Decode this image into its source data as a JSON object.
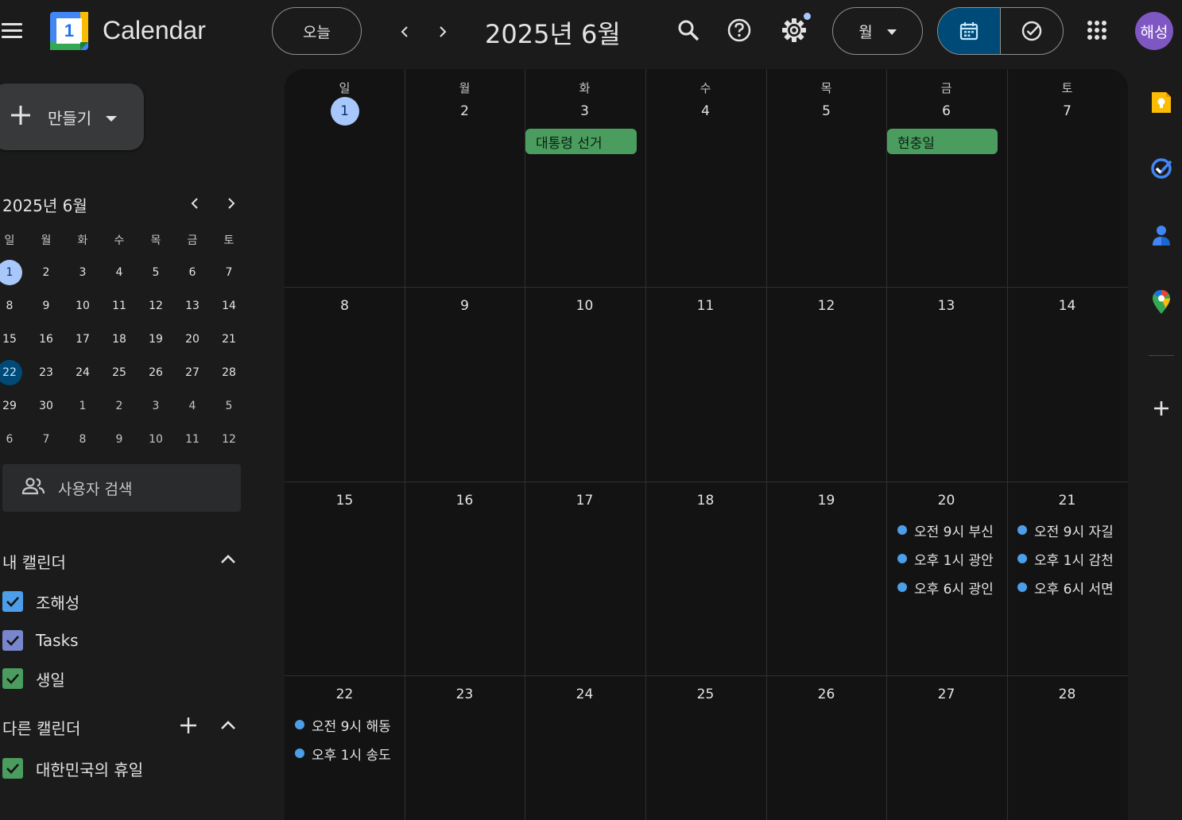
{
  "header": {
    "app_title": "Calendar",
    "logo_day": "1",
    "today_label": "오늘",
    "period_title": "2025년 6월",
    "view_label": "월",
    "avatar_text": "해성",
    "icons": [
      "menu-icon",
      "chevron-left-icon",
      "chevron-right-icon",
      "search-icon",
      "help-icon",
      "settings-icon",
      "calendar-view-icon",
      "tasks-view-icon",
      "apps-grid-icon"
    ],
    "colors": {
      "accent": "#a8c7fa",
      "selected_segment": "#004a77",
      "avatar": "#7e57c2"
    }
  },
  "sidebar": {
    "create_label": "만들기",
    "mini_calendar": {
      "title": "2025년 6월",
      "weekdays": [
        "일",
        "월",
        "화",
        "수",
        "목",
        "금",
        "토"
      ],
      "weeks": [
        [
          "1",
          "2",
          "3",
          "4",
          "5",
          "6",
          "7"
        ],
        [
          "8",
          "9",
          "10",
          "11",
          "12",
          "13",
          "14"
        ],
        [
          "15",
          "16",
          "17",
          "18",
          "19",
          "20",
          "21"
        ],
        [
          "22",
          "23",
          "24",
          "25",
          "26",
          "27",
          "28"
        ],
        [
          "29",
          "30",
          "1",
          "2",
          "3",
          "4",
          "5"
        ],
        [
          "6",
          "7",
          "8",
          "9",
          "10",
          "11",
          "12"
        ]
      ],
      "today": "1",
      "selected": "22"
    },
    "people_search_label": "사용자 검색",
    "my_calendars": {
      "title": "내 캘린더",
      "items": [
        {
          "label": "조해성",
          "color": "#4c9ee8"
        },
        {
          "label": "Tasks",
          "color": "#7986cb"
        },
        {
          "label": "생일",
          "color": "#4a9d5e"
        }
      ]
    },
    "other_calendars": {
      "title": "다른 캘린더",
      "items": [
        {
          "label": "대한민국의 휴일",
          "color": "#4a9d5e"
        }
      ]
    }
  },
  "month_view": {
    "weekdays": [
      "일",
      "월",
      "화",
      "수",
      "목",
      "금",
      "토"
    ],
    "weeks": [
      [
        "1",
        "2",
        "3",
        "4",
        "5",
        "6",
        "7"
      ],
      [
        "8",
        "9",
        "10",
        "11",
        "12",
        "13",
        "14"
      ],
      [
        "15",
        "16",
        "17",
        "18",
        "19",
        "20",
        "21"
      ],
      [
        "22",
        "23",
        "24",
        "25",
        "26",
        "27",
        "28"
      ]
    ],
    "today": "1",
    "all_day_events": [
      {
        "date": "3",
        "title": "대통령 선거",
        "color": "#4a9d5e"
      },
      {
        "date": "6",
        "title": "현충일",
        "color": "#4a9d5e"
      }
    ],
    "timed_events": {
      "20": [
        "오전 9시 부신",
        "오후 1시 광안",
        "오후 6시 광인"
      ],
      "21": [
        "오전 9시 자길",
        "오후 1시 감천",
        "오후 6시 서면"
      ],
      "22": [
        "오전 9시 해동",
        "오후 1시 송도"
      ]
    }
  },
  "right_rail": {
    "icons": [
      "keep-icon",
      "tasks-icon",
      "contacts-icon",
      "maps-icon",
      "add-icon"
    ]
  }
}
